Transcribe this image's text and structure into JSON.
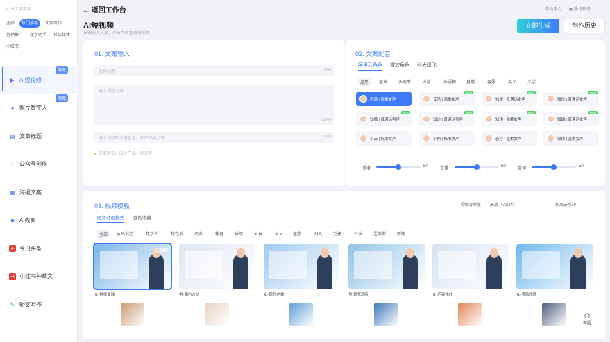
{
  "sidebar": {
    "search_placeholder": "今文案搜索",
    "tags": [
      {
        "label": "全部",
        "active": false
      },
      {
        "label": "热门推荐",
        "active": true
      },
      {
        "label": "文案写作",
        "active": false
      },
      {
        "label": "营销推广",
        "active": false
      },
      {
        "label": "数字助手",
        "active": false
      },
      {
        "label": "社交媒体",
        "active": false
      },
      {
        "label": "小红书",
        "active": false
      }
    ],
    "items": [
      {
        "label": "AI短视频",
        "icon": "video-icon",
        "badge": "限免",
        "active": true
      },
      {
        "label": "照片数字人",
        "icon": "person-icon",
        "badge": "限免",
        "active": false
      },
      {
        "label": "文章标题",
        "icon": "article-icon",
        "badge": "",
        "active": false
      },
      {
        "label": "公众号创作",
        "icon": "wechat-icon",
        "badge": "",
        "active": false
      },
      {
        "label": "海报文案",
        "icon": "poster-icon",
        "badge": "",
        "active": false
      },
      {
        "label": "AI教案",
        "icon": "education-icon",
        "badge": "",
        "active": false
      },
      {
        "label": "今日头条",
        "icon": "toutiao-icon",
        "badge": "",
        "active": false
      },
      {
        "label": "小红书种草文",
        "icon": "xiaohongshu-icon",
        "badge": "",
        "active": false
      },
      {
        "label": "短文写作",
        "icon": "short-text-icon",
        "badge": "",
        "active": false
      }
    ]
  },
  "header": {
    "back_label": "返回工作台",
    "links": [
      "帮助中心",
      "操作指南"
    ],
    "title": "AI短视频",
    "subtitle": "只需输入文案，AI将为你生成短视频",
    "generate_button": "立即生成",
    "history_button": "创作历史"
  },
  "copy_input": {
    "section_title": "01. 文案输入",
    "title_placeholder": "视频标题",
    "title_counter": "0/30",
    "body_placeholder": "输入视频文案",
    "body_counter": "0/1000",
    "extra_placeholder": "输入视频的关键信息，如产品卖点等",
    "extra_counter": "0/100",
    "hint": "文案建议：描述产品、场景等"
  },
  "voiceover": {
    "section_title": "02. 文案配音",
    "source_tabs": [
      {
        "label": "阿里云角色",
        "selected": true
      },
      {
        "label": "微软角色",
        "selected": false
      },
      {
        "label": "科大讯飞",
        "selected": false
      }
    ],
    "categories": [
      {
        "label": "通用",
        "selected": true
      },
      {
        "label": "童声",
        "selected": false
      },
      {
        "label": "多情感",
        "selected": false
      },
      {
        "label": "方言",
        "selected": false
      },
      {
        "label": "多语种",
        "selected": false
      },
      {
        "label": "直播",
        "selected": false
      },
      {
        "label": "客服",
        "selected": false
      },
      {
        "label": "英文",
        "selected": false
      },
      {
        "label": "文学",
        "selected": false
      }
    ],
    "voices": [
      {
        "label": "思晴 | 温柔女声",
        "selected": true,
        "is_new": false
      },
      {
        "label": "艾晴 | 温柔女声",
        "selected": false,
        "is_new": true
      },
      {
        "label": "知媛 | 普通话女声",
        "selected": false,
        "is_new": true
      },
      {
        "label": "知怡 | 普通话女声",
        "selected": false,
        "is_new": true
      },
      {
        "label": "知楠 | 普通话男声",
        "selected": false,
        "is_new": true
      },
      {
        "label": "知达 | 普通话男声",
        "selected": false,
        "is_new": true
      },
      {
        "label": "知琪 | 温柔女声",
        "selected": false,
        "is_new": true
      },
      {
        "label": "知甜 | 普通话女声",
        "selected": false,
        "is_new": true
      },
      {
        "label": "小云 | 标准女声",
        "selected": false,
        "is_new": false
      },
      {
        "label": "小刚 | 标准男声",
        "selected": false,
        "is_new": false
      },
      {
        "label": "若兮 | 温柔女声",
        "selected": false,
        "is_new": false
      },
      {
        "label": "思琪 | 温柔女声",
        "selected": false,
        "is_new": false
      }
    ],
    "sliders": [
      {
        "label": "语速",
        "value": 50,
        "fraction": 0.5
      },
      {
        "label": "音量",
        "value": 50,
        "fraction": 0.5
      },
      {
        "label": "音调",
        "value": 50,
        "fraction": 0.5
      }
    ]
  },
  "templates": {
    "section_title": "03. 视频模板",
    "tabs": [
      {
        "label": "图文动画模式",
        "selected": true
      },
      {
        "label": "我的收藏",
        "selected": false
      }
    ],
    "quality_label": "视频清晰度",
    "quality_value": "高清（720P）",
    "watermark_label": "作品去水印",
    "categories": [
      {
        "label": "全部",
        "selected": true
      },
      {
        "label": "古风说话",
        "selected": false
      },
      {
        "label": "数字人",
        "selected": false
      },
      {
        "label": "粉色系",
        "selected": false
      },
      {
        "label": "商务",
        "selected": false
      },
      {
        "label": "教育",
        "selected": false
      },
      {
        "label": "自然",
        "selected": false
      },
      {
        "label": "节日",
        "selected": false
      },
      {
        "label": "节日",
        "selected": false
      },
      {
        "label": "童趣",
        "selected": false
      },
      {
        "label": "国风",
        "selected": false
      },
      {
        "label": "党建",
        "selected": false
      },
      {
        "label": "科技",
        "selected": false
      },
      {
        "label": "孟菲斯",
        "selected": false
      },
      {
        "label": "新版",
        "selected": false
      }
    ],
    "items": [
      {
        "label": "女-科技星球",
        "selected": true,
        "brand": "万彩AI",
        "bg": "#7cb6e8"
      },
      {
        "label": "男-简约方块",
        "selected": false,
        "brand": "",
        "bg": "#dfe6ef"
      },
      {
        "label": "女-现代色板",
        "selected": false,
        "brand": "",
        "bg": "#9ec9ee"
      },
      {
        "label": "男-现代圆盘",
        "selected": false,
        "brand": "",
        "bg": "#8fc3e6"
      },
      {
        "label": "女-闪亮光线",
        "selected": false,
        "brand": "",
        "bg": "#d5e3f0"
      },
      {
        "label": "女-灵动光圈",
        "selected": false,
        "brand": "",
        "bg": "#6fb7ec"
      }
    ],
    "thumbs": [
      {
        "color": "#c89b74"
      },
      {
        "color": "#e6d2c0"
      },
      {
        "color": "#5fa0d8"
      },
      {
        "color": "#3e78b8"
      },
      {
        "color": "#e2835a"
      },
      {
        "color": "#4e5f7e"
      }
    ]
  },
  "support": {
    "label": "客服"
  }
}
